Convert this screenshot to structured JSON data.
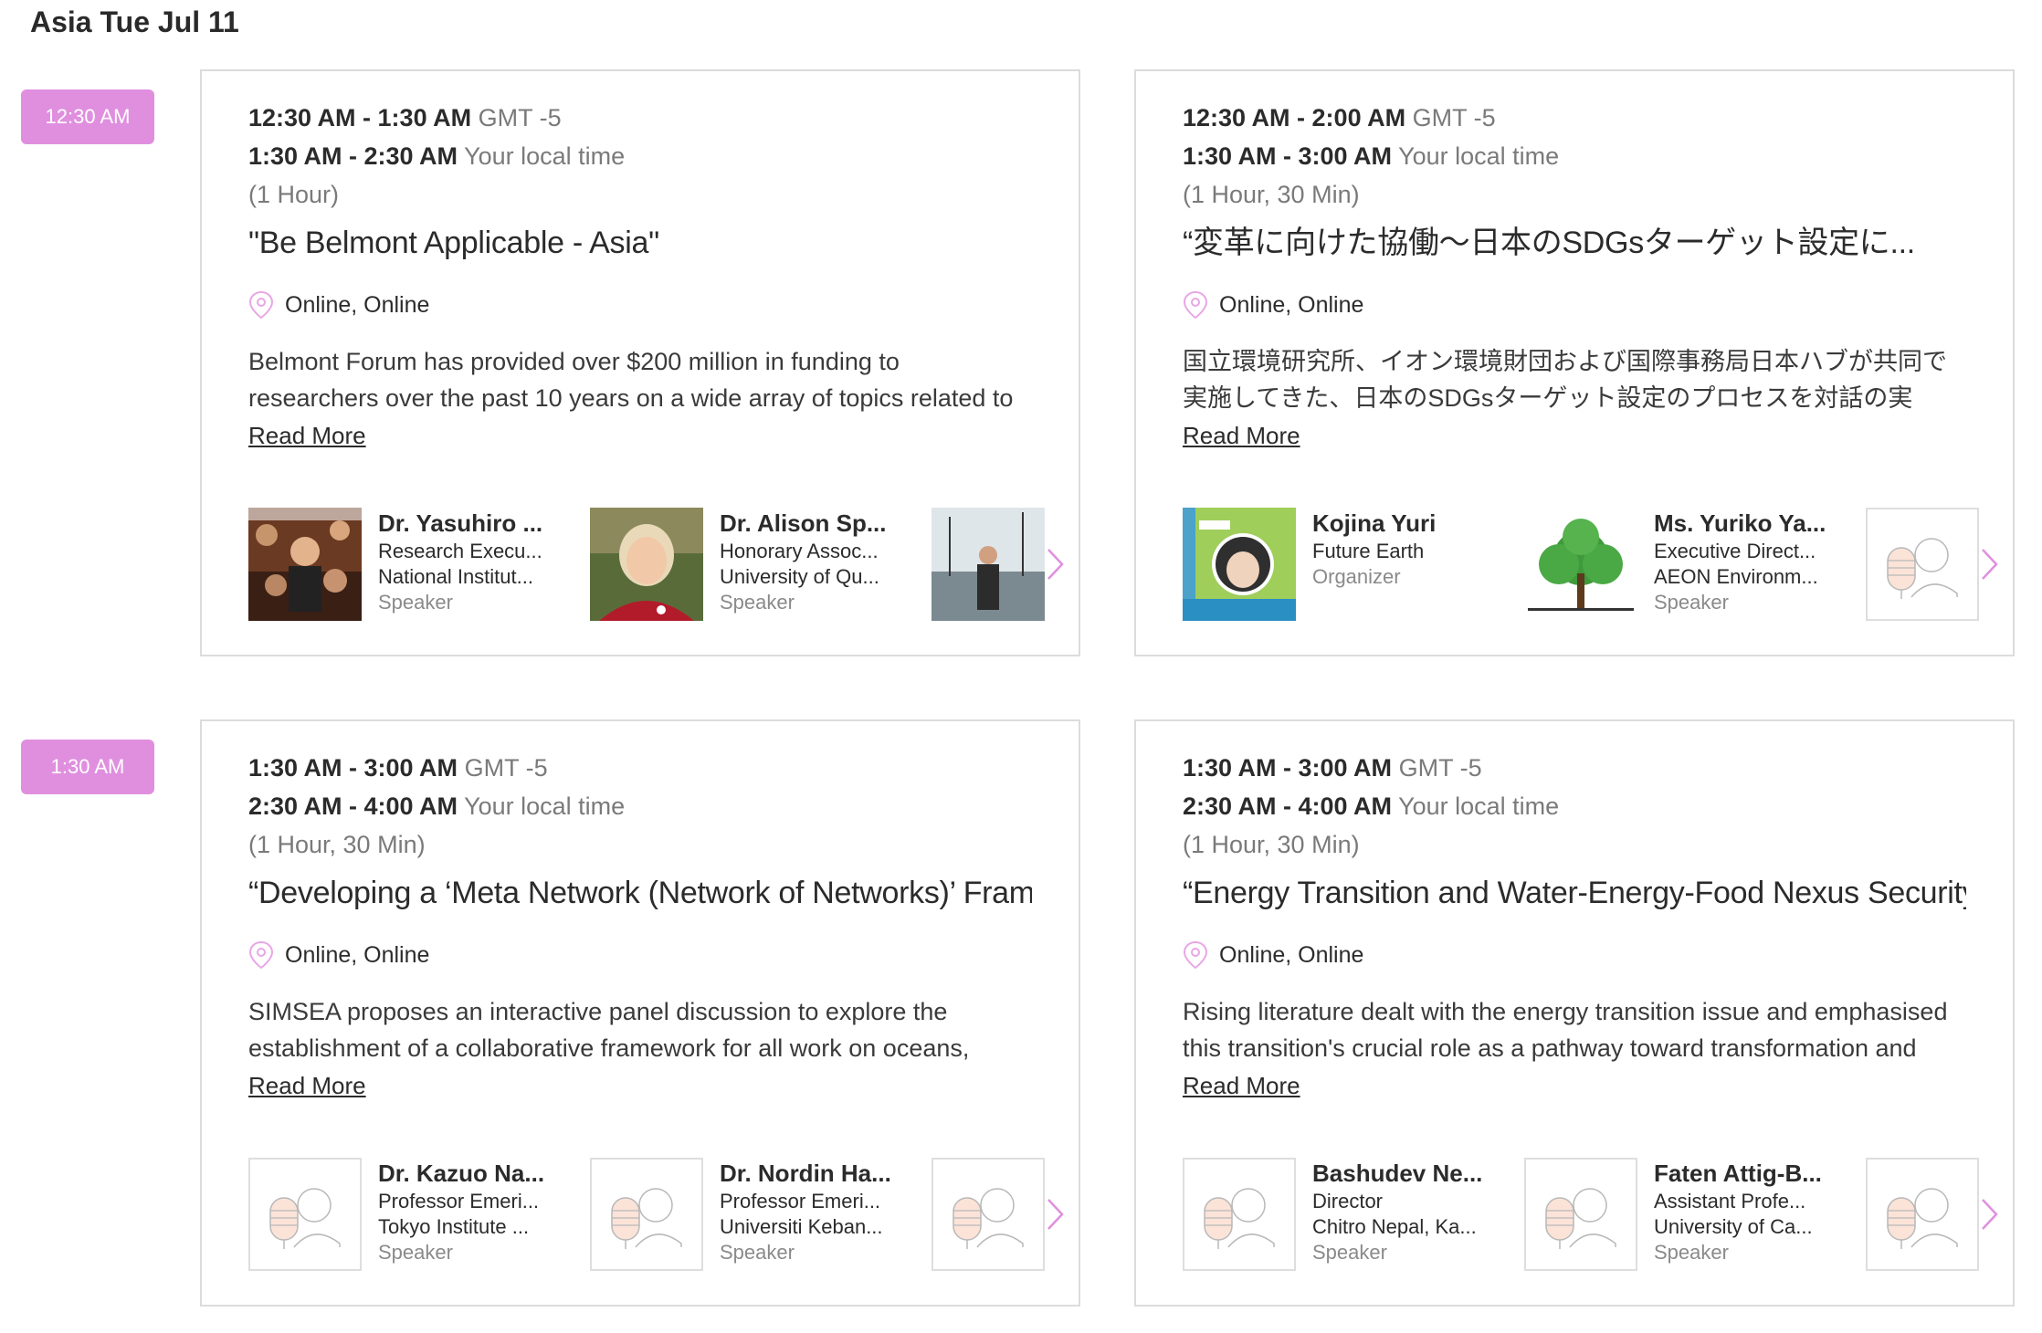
{
  "day_header": "Asia Tue Jul 11",
  "accent_color": "#e08fdf",
  "slots": [
    {
      "badge": "12:30 AM",
      "sessions": [
        {
          "gmt_range": "12:30 AM - 1:30 AM",
          "gmt_label": "GMT -5",
          "local_range": "1:30 AM - 2:30 AM",
          "local_label": "Your local time",
          "duration": "(1 Hour)",
          "title": "\"Be Belmont Applicable - Asia\"",
          "location": "Online, Online",
          "description": "Belmont Forum has provided over $200 million in funding to researchers over the past 10 years on a wide array of topics related to mitigating and",
          "read_more": "Read More",
          "speakers": [
            {
              "name": "Dr. Yasuhiro ...",
              "line1": "Research Execu...",
              "line2": "National Institut...",
              "role": "Speaker",
              "avatar": "photo-presenter"
            },
            {
              "name": "Dr. Alison Sp...",
              "line1": "Honorary Assoc...",
              "line2": "University of Qu...",
              "role": "Speaker",
              "avatar": "photo-woman"
            },
            {
              "name": "",
              "line1": "",
              "line2": "",
              "role": "",
              "avatar": "photo-harbor"
            }
          ]
        },
        {
          "gmt_range": "12:30 AM - 2:00 AM",
          "gmt_label": "GMT -5",
          "local_range": "1:30 AM - 3:00 AM",
          "local_label": "Your local time",
          "duration": "(1 Hour, 30 Min)",
          "title": "“変革に向けた協働～日本のSDGsターゲット設定に...",
          "location": "Online, Online",
          "description": "国立環境研究所、イオン環境財団および国際事務局日本ハブが共同で実施してきた、日本のSDGsターゲット設定のプロセスを対話の実",
          "read_more": "Read More",
          "speakers": [
            {
              "name": "Kojina Yuri",
              "line1": "Future Earth",
              "line2": "Organizer",
              "role": "",
              "avatar": "photo-poster"
            },
            {
              "name": "Ms. Yuriko Ya...",
              "line1": "Executive Direct...",
              "line2": "AEON Environm...",
              "role": "Speaker",
              "avatar": "tree-logo"
            },
            {
              "name": "",
              "line1": "",
              "line2": "",
              "role": "",
              "avatar": "placeholder"
            }
          ]
        }
      ]
    },
    {
      "badge": "1:30 AM",
      "sessions": [
        {
          "gmt_range": "1:30 AM - 3:00 AM",
          "gmt_label": "GMT -5",
          "local_range": "2:30 AM - 4:00 AM",
          "local_label": "Your local time",
          "duration": "(1 Hour, 30 Min)",
          "title": "“Developing a ‘Meta Network (Network of Networks)’ Frame...",
          "location": "Online, Online",
          "description": "SIMSEA proposes an interactive panel discussion to explore the establishment of a collaborative framework for all work on oceans,",
          "read_more": "Read More",
          "speakers": [
            {
              "name": "Dr. Kazuo Na...",
              "line1": "Professor Emeri...",
              "line2": "Tokyo Institute ...",
              "role": "Speaker",
              "avatar": "placeholder"
            },
            {
              "name": "Dr. Nordin Ha...",
              "line1": "Professor Emeri...",
              "line2": "Universiti Keban...",
              "role": "Speaker",
              "avatar": "placeholder"
            },
            {
              "name": "",
              "line1": "",
              "line2": "",
              "role": "",
              "avatar": "placeholder"
            }
          ]
        },
        {
          "gmt_range": "1:30 AM - 3:00 AM",
          "gmt_label": "GMT -5",
          "local_range": "2:30 AM - 4:00 AM",
          "local_label": "Your local time",
          "duration": "(1 Hour, 30 Min)",
          "title": "“Energy Transition and Water-Energy-Food Nexus Security: ...",
          "location": "Online, Online",
          "description": "Rising literature dealt with the energy transition issue and emphasised this transition's crucial role as a pathway toward transformation and",
          "read_more": "Read More",
          "speakers": [
            {
              "name": "Bashudev Ne...",
              "line1": "Director",
              "line2": "Chitro Nepal, Ka...",
              "role": "Speaker",
              "avatar": "placeholder"
            },
            {
              "name": "Faten Attig-B...",
              "line1": "Assistant Profe...",
              "line2": "University of Ca...",
              "role": "Speaker",
              "avatar": "placeholder"
            },
            {
              "name": "",
              "line1": "",
              "line2": "",
              "role": "",
              "avatar": "placeholder"
            }
          ]
        }
      ]
    }
  ]
}
